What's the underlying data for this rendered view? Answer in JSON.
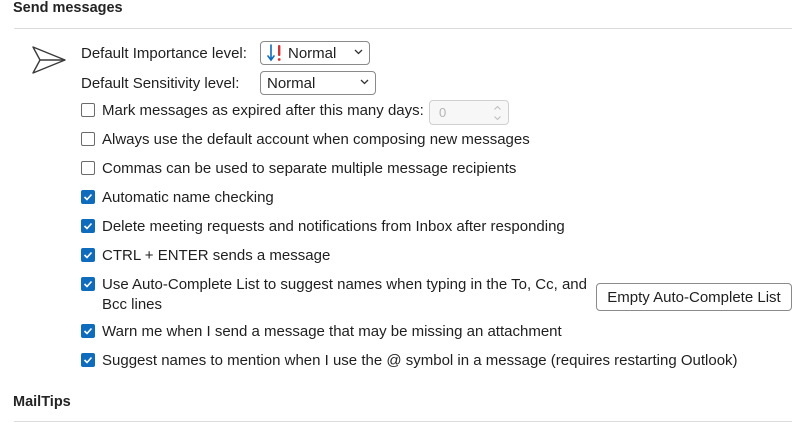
{
  "send_messages": {
    "title": "Send messages",
    "importance_label": "Default Importance level:",
    "importance_value": "Normal",
    "sensitivity_label": "Default Sensitivity level:",
    "sensitivity_value": "Normal",
    "options": [
      {
        "label": "Mark messages as expired after this many days:",
        "checked": false
      },
      {
        "label": "Always use the default account when composing new messages",
        "checked": false
      },
      {
        "label": "Commas can be used to separate multiple message recipients",
        "checked": false
      },
      {
        "label": "Automatic name checking",
        "checked": true
      },
      {
        "label": "Delete meeting requests and notifications from Inbox after responding",
        "checked": true
      },
      {
        "label": "CTRL + ENTER sends a message",
        "checked": true
      },
      {
        "label": "Use Auto-Complete List to suggest names when typing in the To, Cc, and Bcc lines",
        "checked": true
      },
      {
        "label": "Warn me when I send a message that may be missing an attachment",
        "checked": true
      },
      {
        "label": "Suggest names to mention when I use the @ symbol in a message (requires restarting Outlook)",
        "checked": true
      }
    ],
    "expire_days_value": "0",
    "empty_autocomplete_label": "Empty Auto-Complete List"
  },
  "mailtips": {
    "title": "MailTips"
  },
  "colors": {
    "checkbox_checked": "#0f6cbd",
    "importance_arrow": "#0f6cbd",
    "importance_exclaim": "#d13438"
  },
  "icons": {
    "section_icon": "send-icon",
    "importance_icon": "importance-icon",
    "dropdown": "chevron-down-icon"
  }
}
